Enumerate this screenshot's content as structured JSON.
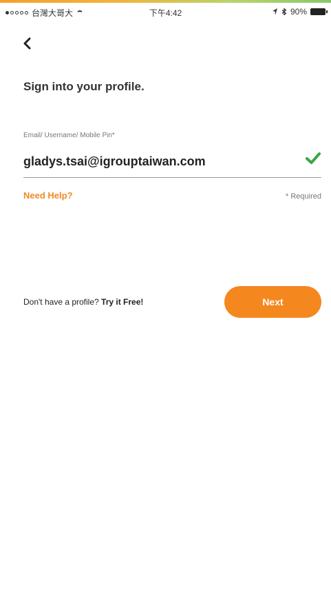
{
  "status_bar": {
    "carrier": "台灣大哥大",
    "time": "下午4:42",
    "battery": "90%"
  },
  "header": {
    "back_icon": "chevron-left-icon"
  },
  "page": {
    "title": "Sign into your profile."
  },
  "form": {
    "email_label": "Email/ Username/ Mobile Pin*",
    "email_value": "gladys.tsai@igrouptaiwan.com",
    "valid_icon": "check-icon",
    "need_help": "Need Help?",
    "required_note": "* Required"
  },
  "footer": {
    "no_profile_text": "Don't have a profile? ",
    "try_free": "Try it Free!",
    "next_label": "Next"
  },
  "colors": {
    "accent": "#f5871f",
    "success": "#3aa64a",
    "text": "#222222"
  }
}
